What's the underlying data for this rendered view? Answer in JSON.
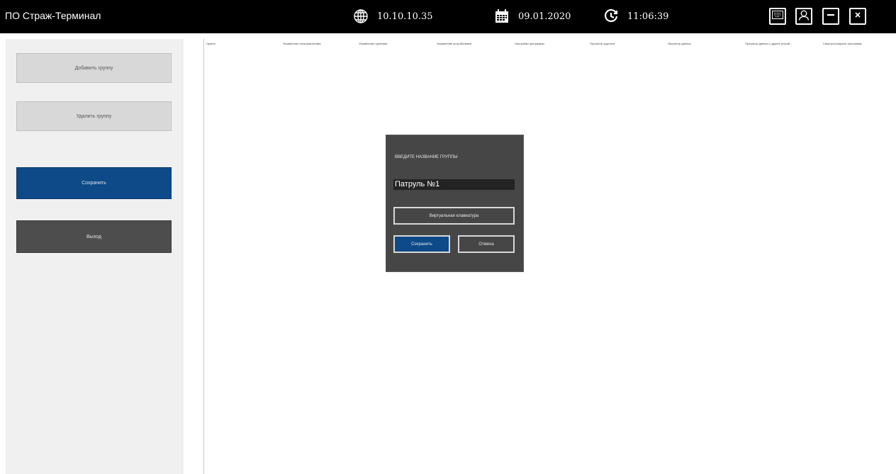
{
  "app": {
    "title": "ПО Страж-Терминал"
  },
  "header": {
    "ip": "10.10.10.35",
    "date": "09.01.2020",
    "time": "11:06:39",
    "icons": {
      "ip": "globe-icon",
      "date": "calendar-icon",
      "time": "clock-icon"
    },
    "buttons": [
      "keyboard-icon",
      "user-icon",
      "minimize-icon",
      "close-icon"
    ]
  },
  "sidebar": {
    "add_group": "Добавить группу",
    "remove_group": "Удалить группу",
    "save": "Сохранить",
    "exit": "Выход"
  },
  "table": {
    "columns": [
      "Группа",
      "Управление пользователями",
      "Управление группами",
      "Управление устройствами",
      "Настройки программы",
      "Просмотр журнала",
      "Просмотр данных",
      "Просмотр данных с других устрой...",
      "Свернуть/закрыть программу"
    ]
  },
  "dialog": {
    "prompt": "ВВЕДИТЕ НАЗВАНИЕ ГРУППЫ",
    "input_value": "Патруль №1",
    "keyboard_button": "Виртуальная клавиатура",
    "save_button": "Сохранить",
    "cancel_button": "Отмена"
  },
  "colors": {
    "topbar": "#000000",
    "accent_blue": "#0e4a87",
    "dark_button": "#4d4d4d",
    "dialog_bg": "#464646",
    "sidebar_bg": "#f0f0f0"
  }
}
